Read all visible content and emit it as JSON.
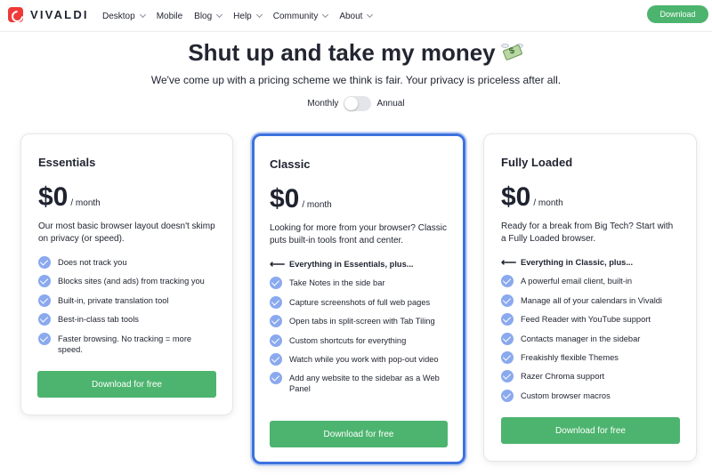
{
  "header": {
    "brand": "VIVALDI",
    "nav": [
      {
        "label": "Desktop",
        "dropdown": true
      },
      {
        "label": "Mobile",
        "dropdown": false
      },
      {
        "label": "Blog",
        "dropdown": true
      },
      {
        "label": "Help",
        "dropdown": true
      },
      {
        "label": "Community",
        "dropdown": true
      },
      {
        "label": "About",
        "dropdown": true
      }
    ],
    "download_label": "Download"
  },
  "hero": {
    "title": "Shut up and take my money",
    "title_icon": "money-with-wings-icon",
    "subtitle": "We've come up with a pricing scheme we think is fair. Your privacy is priceless after all."
  },
  "billing": {
    "monthly_label": "Monthly",
    "annual_label": "Annual",
    "selected": "Monthly"
  },
  "plans": [
    {
      "title": "Essentials",
      "price": "$0",
      "period": "/ month",
      "description": "Our most basic browser layout doesn't skimp on privacy (or speed).",
      "features": [
        "Does not track you",
        "Blocks sites (and ads) from tracking you",
        "Built-in, private translation tool",
        "Best-in-class tab tools",
        "Faster browsing. No tracking = more speed."
      ],
      "button_label": "Download for free"
    },
    {
      "title": "Classic",
      "price": "$0",
      "period": "/ month",
      "description": "Looking for more from your browser? Classic puts built-in tools front and center.",
      "includes": "Everything in Essentials, plus...",
      "features": [
        "Take Notes in the side bar",
        "Capture screenshots of full web pages",
        "Open tabs in split-screen with Tab Tiling",
        "Custom shortcuts for everything",
        "Watch while you work with pop-out video",
        "Add any website to the sidebar as a Web Panel"
      ],
      "button_label": "Download for free"
    },
    {
      "title": "Fully Loaded",
      "price": "$0",
      "period": "/ month",
      "description": "Ready for a break from Big Tech? Start with a Fully Loaded browser.",
      "includes": "Everything in Classic, plus...",
      "features": [
        "A powerful email client, built-in",
        "Manage all of your calendars in Vivaldi",
        "Feed Reader with YouTube support",
        "Contacts manager in the sidebar",
        "Freakishly flexible Themes",
        "Razer Chroma support",
        "Custom browser macros"
      ],
      "button_label": "Download for free"
    }
  ],
  "colors": {
    "accent_green": "#4cb46e",
    "highlight_blue": "#3d72dd",
    "check_blue": "#8aa9ee",
    "logo_red": "#ef3939"
  }
}
